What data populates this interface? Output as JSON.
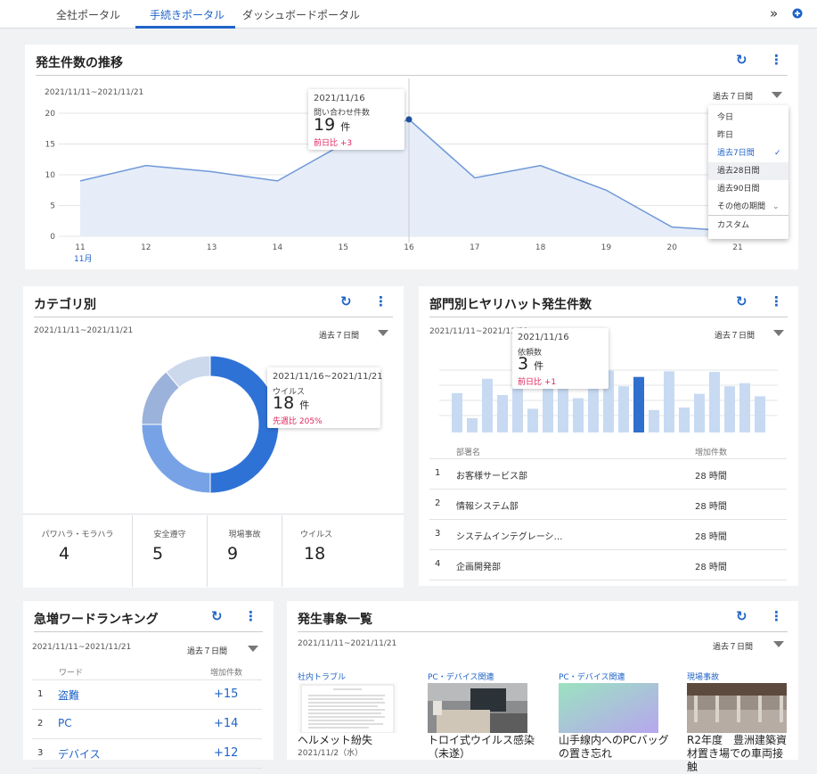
{
  "tabs": [
    {
      "label": "全社ポータル"
    },
    {
      "label": "手続きポータル",
      "active": true
    },
    {
      "label": "ダッシュボードポータル"
    }
  ],
  "header": {
    "expand_icon": "double-chevron-right-icon",
    "add_icon": "plus-circle-icon"
  },
  "trend": {
    "title": "発生件数の推移",
    "range": "2021/11/11~2021/11/21",
    "period": "過去７日間",
    "tooltip": {
      "date": "2021/11/16",
      "label": "問い合わせ件数",
      "value": "19",
      "unit": "件",
      "diff": "前日比 +3"
    },
    "dropdown": [
      {
        "label": "今日"
      },
      {
        "label": "昨日"
      },
      {
        "label": "過去7日間",
        "selected": true
      },
      {
        "label": "過去28日間",
        "hover": true
      },
      {
        "label": "過去90日間"
      },
      {
        "label": "その他の期間"
      },
      {
        "label": "カスタム"
      }
    ],
    "month_label": "11月"
  },
  "chart_data": {
    "type": "area",
    "x": [
      "11",
      "12",
      "13",
      "14",
      "15",
      "16",
      "17",
      "18",
      "19",
      "20",
      "21"
    ],
    "values": [
      9,
      11.5,
      10.5,
      9,
      15,
      19,
      9.5,
      11.5,
      7.5,
      1.5,
      0.8
    ],
    "yticks": [
      "0",
      "5",
      "10",
      "15",
      "20"
    ],
    "ylim": [
      0,
      20
    ],
    "grid": true,
    "highlight_index": 5,
    "colors": {
      "line": "#6f98d8",
      "fill": "#e6edf8",
      "point": "#1f4fa0"
    }
  },
  "category": {
    "title": "カテゴリ別",
    "range": "2021/11/11~2021/11/21",
    "period": "過去７日間",
    "tooltip": {
      "date": "2021/11/16~2021/11/21",
      "label": "ウイルス",
      "value": "18",
      "unit": "件",
      "diff": "先週比 205%"
    },
    "donut": [
      {
        "name": "ウイルス",
        "value": 18,
        "color": "#2f72d6"
      },
      {
        "name": "現場事故",
        "value": 9,
        "color": "#77a3e6"
      },
      {
        "name": "安全遵守",
        "value": 5,
        "color": "#9bb3da"
      },
      {
        "name": "パワハラ・モラハラ",
        "value": 4,
        "color": "#ccd9ec"
      }
    ],
    "stats": [
      {
        "label": "パワハラ・モラハラ",
        "value": "4"
      },
      {
        "label": "安全遵守",
        "value": "5"
      },
      {
        "label": "現場事故",
        "value": "9"
      },
      {
        "label": "ウイルス",
        "value": "18"
      }
    ]
  },
  "dept": {
    "title": "部門別ヒヤリハット発生件数",
    "range": "2021/11/11~2021/11/21",
    "period": "過去７日間",
    "tooltip": {
      "date": "2021/11/16",
      "label": "依頼数",
      "value": "3",
      "unit": "件",
      "diff": "前日比 +1"
    },
    "bars": [
      0.63,
      0.23,
      0.86,
      0.6,
      0.76,
      0.38,
      0.75,
      0.72,
      0.55,
      0.9,
      0.99,
      0.74,
      0.89,
      0.36,
      0.98,
      0.4,
      0.62,
      0.97,
      0.74,
      0.79,
      0.58
    ],
    "highlight_bar": 12,
    "columns": [
      "部署名",
      "増加件数"
    ],
    "rows": [
      {
        "num": "1",
        "name": "お客様サービス部",
        "value": "28 時間"
      },
      {
        "num": "2",
        "name": "情報システム部",
        "value": "28 時間"
      },
      {
        "num": "3",
        "name": "システムインテグレーシ…",
        "value": "28 時間"
      },
      {
        "num": "4",
        "name": "企画開発部",
        "value": "28 時間"
      }
    ]
  },
  "ranking": {
    "title": "急増ワードランキング",
    "range": "2021/11/11~2021/11/21",
    "period": "過去７日間",
    "columns": [
      "ワード",
      "増加件数"
    ],
    "rows": [
      {
        "num": "1",
        "word": "盗難",
        "inc": "+15"
      },
      {
        "num": "2",
        "word": "PC",
        "inc": "+14"
      },
      {
        "num": "3",
        "word": "デバイス",
        "inc": "+12"
      }
    ]
  },
  "incidents": {
    "title": "発生事象一覧",
    "range": "2021/11/11~2021/11/21",
    "period": "過去７日間",
    "items": [
      {
        "category": "社内トラブル",
        "title": "ヘルメット紛失",
        "date": "2021/11/2（水）"
      },
      {
        "category": "PC・デバイス関連",
        "title": "トロイ式ウイルス感染（未遂）"
      },
      {
        "category": "PC・デバイス関連",
        "title": "山手線内へのPCバッグの置き忘れ"
      },
      {
        "category": "現場事故",
        "title": "R2年度　豊洲建築資材置き場での車両接触"
      }
    ]
  }
}
